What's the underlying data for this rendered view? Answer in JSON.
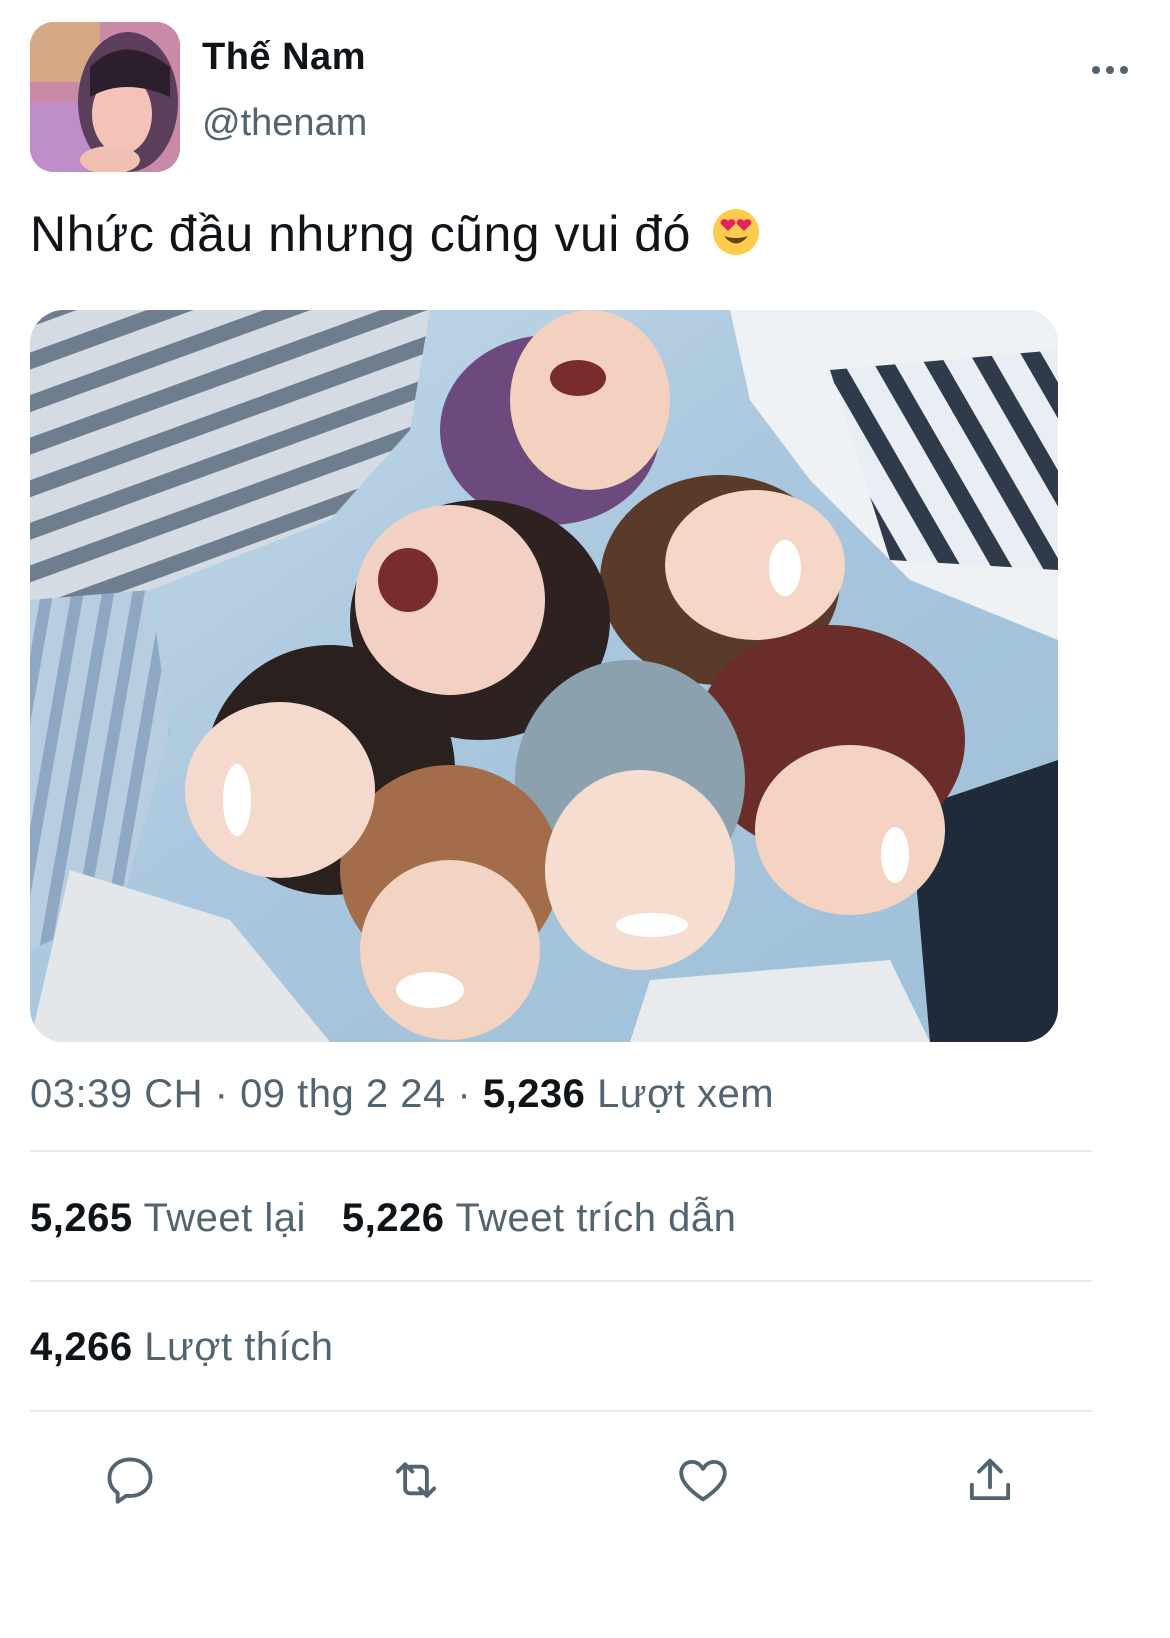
{
  "author": {
    "display_name": "Thế Nam",
    "handle": "@thenam"
  },
  "tweet": {
    "text": "Nhức đầu nhưng cũng vui đó",
    "emoji": "heart-eyes-emoji"
  },
  "meta": {
    "time": "03:39 CH",
    "separator": "·",
    "date": "09 thg 2 24",
    "views_count": "5,236",
    "views_label": "Lượt xem"
  },
  "stats": {
    "retweets_count": "5,265",
    "retweets_label": "Tweet lại",
    "quotes_count": "5,226",
    "quotes_label": "Tweet trích dẫn",
    "likes_count": "4,266",
    "likes_label": "Lượt thích"
  },
  "actions": [
    "reply-icon",
    "retweet-icon",
    "like-icon",
    "share-icon"
  ],
  "colors": {
    "text_primary": "#0f1419",
    "text_secondary": "#536471",
    "divider": "#e8eaed",
    "icon": "#536471"
  }
}
